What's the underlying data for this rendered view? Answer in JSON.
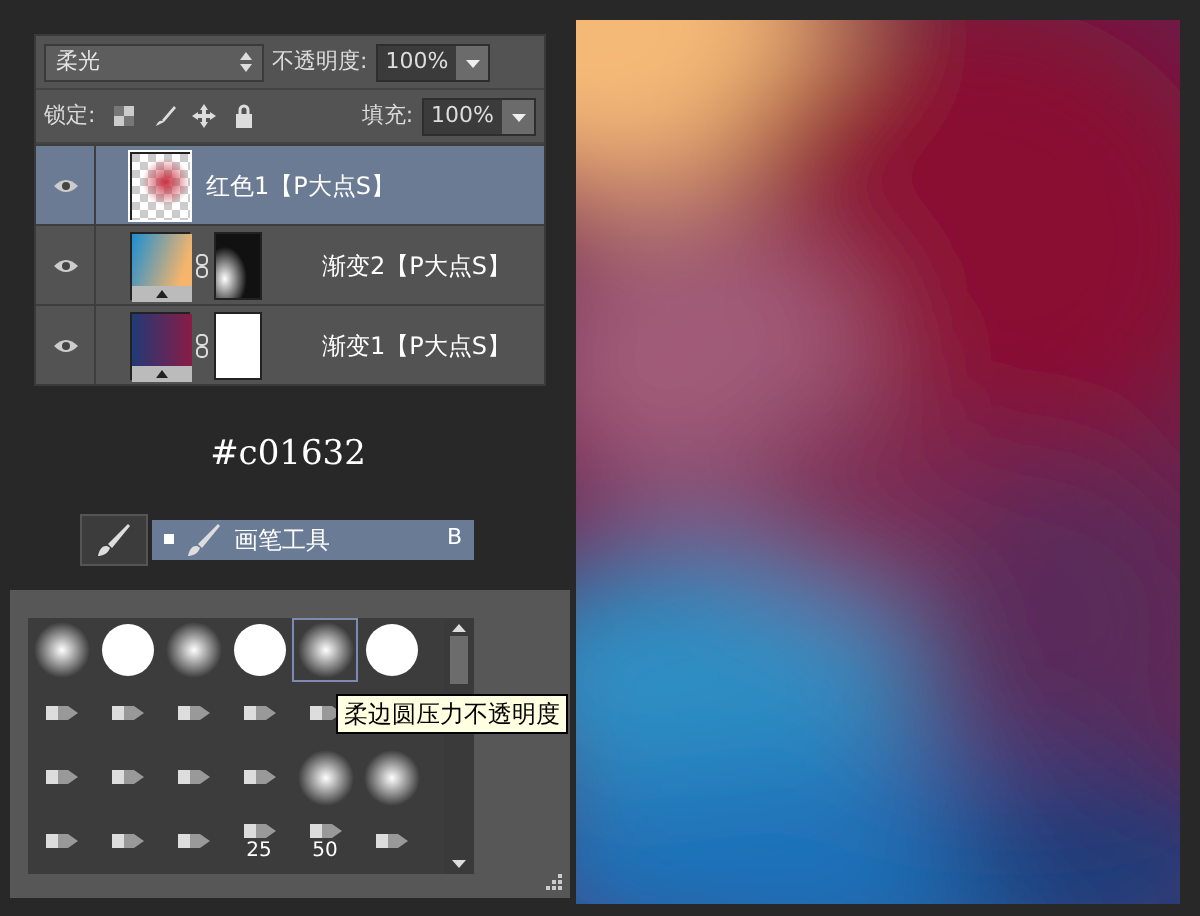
{
  "layers_panel": {
    "blend_mode": "柔光",
    "opacity_label": "不透明度:",
    "opacity_value": "100%",
    "lock_label": "锁定:",
    "fill_label": "填充:",
    "fill_value": "100%",
    "layers": [
      {
        "name": "红色1【P大点S】",
        "visible": true,
        "selected": true,
        "kind": "pixel"
      },
      {
        "name": "渐变2【P大点S】",
        "visible": true,
        "selected": false,
        "kind": "gradient-warm",
        "mask": {
          "kind": "soft"
        }
      },
      {
        "name": "渐变1【P大点S】",
        "visible": true,
        "selected": false,
        "kind": "gradient-dark",
        "mask": {
          "kind": "solid"
        }
      }
    ]
  },
  "color_caption": "#c01632",
  "tool_preset": {
    "name": "画笔工具",
    "shortcut": "B"
  },
  "brush_picker": {
    "tooltip": "柔边圆压力不透明度",
    "rows": [
      {
        "brushes": [
          {
            "kind": "soft",
            "selected": false
          },
          {
            "kind": "hard",
            "selected": false
          },
          {
            "kind": "soft",
            "selected": false
          },
          {
            "kind": "hard",
            "selected": false
          },
          {
            "kind": "soft",
            "selected": true
          },
          {
            "kind": "hard",
            "selected": false
          }
        ]
      },
      {
        "brushes": [
          {
            "kind": "tip",
            "selected": false
          },
          {
            "kind": "tip",
            "selected": false
          },
          {
            "kind": "tip",
            "selected": false
          },
          {
            "kind": "tip",
            "selected": false
          },
          {
            "kind": "tip",
            "selected": false
          }
        ]
      },
      {
        "brushes": [
          {
            "kind": "tip",
            "selected": false
          },
          {
            "kind": "tip",
            "selected": false
          },
          {
            "kind": "tip",
            "selected": false
          },
          {
            "kind": "tip",
            "selected": false
          },
          {
            "kind": "soft",
            "selected": false
          },
          {
            "kind": "soft",
            "selected": false
          }
        ]
      },
      {
        "brushes": [
          {
            "kind": "tip",
            "selected": false
          },
          {
            "kind": "tip",
            "selected": false
          },
          {
            "kind": "tip",
            "selected": false
          },
          {
            "kind": "tip",
            "selected": false,
            "size": "25"
          },
          {
            "kind": "tip",
            "selected": false,
            "size": "50"
          },
          {
            "kind": "tip",
            "selected": false
          }
        ]
      }
    ]
  }
}
